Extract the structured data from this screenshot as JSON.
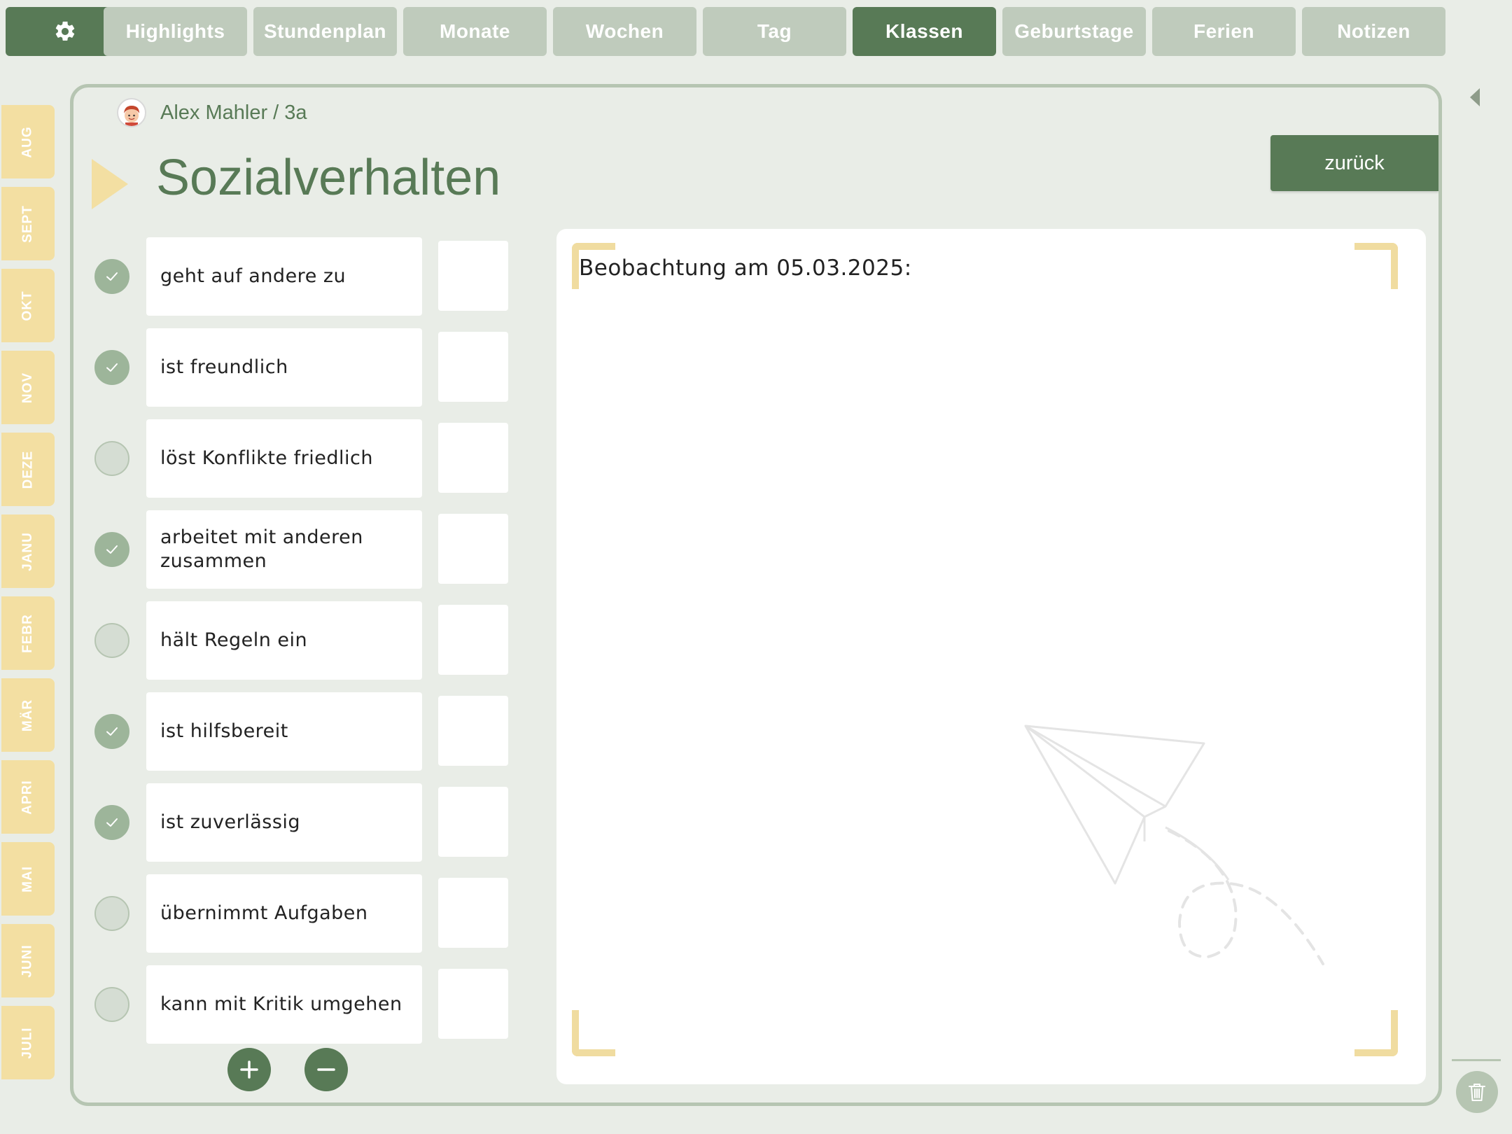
{
  "top_tabs": {
    "settings_icon": "gear-icon",
    "items": [
      {
        "label": "Highlights"
      },
      {
        "label": "Stundenplan"
      },
      {
        "label": "Monate"
      },
      {
        "label": "Wochen"
      },
      {
        "label": "Tag"
      },
      {
        "label": "Klassen",
        "active": true
      },
      {
        "label": "Geburtstage"
      },
      {
        "label": "Ferien"
      },
      {
        "label": "Notizen"
      }
    ]
  },
  "months": [
    "AUG",
    "SEPT",
    "OKT",
    "NOV",
    "DEZE",
    "JANU",
    "FEBR",
    "MÄR",
    "APRI",
    "MAI",
    "JUNI",
    "JULI"
  ],
  "breadcrumb": {
    "text": "Alex Mahler / 3a",
    "avatar_icon": "student-avatar"
  },
  "page": {
    "title": "Sozialverhalten",
    "back_label": "zurück"
  },
  "criteria": [
    {
      "label": "geht auf andere zu",
      "checked": true
    },
    {
      "label": "ist freundlich",
      "checked": true
    },
    {
      "label": "löst Konflikte friedlich",
      "checked": false
    },
    {
      "label": "arbeitet mit anderen zusammen",
      "checked": true
    },
    {
      "label": "hält Regeln ein",
      "checked": false
    },
    {
      "label": "ist hilfsbereit",
      "checked": true
    },
    {
      "label": "ist zuverlässig",
      "checked": true
    },
    {
      "label": "übernimmt Aufgaben",
      "checked": false
    },
    {
      "label": "kann mit Kritik umgehen",
      "checked": false
    }
  ],
  "list_controls": {
    "add_icon": "plus-icon",
    "remove_icon": "minus-icon"
  },
  "notes": {
    "text": "Beobachtung am 05.03.2025:",
    "decoration_icon": "paper-plane-icon"
  },
  "right_edge": {
    "collapse_icon": "collapse-left-icon",
    "trash_icon": "trash-icon"
  },
  "colors": {
    "primary_green": "#587a56",
    "inactive_tab": "#bfcbbc",
    "check_on": "#9db59a",
    "accent_yellow": "#f3dfa2",
    "background": "#e9ede7"
  }
}
